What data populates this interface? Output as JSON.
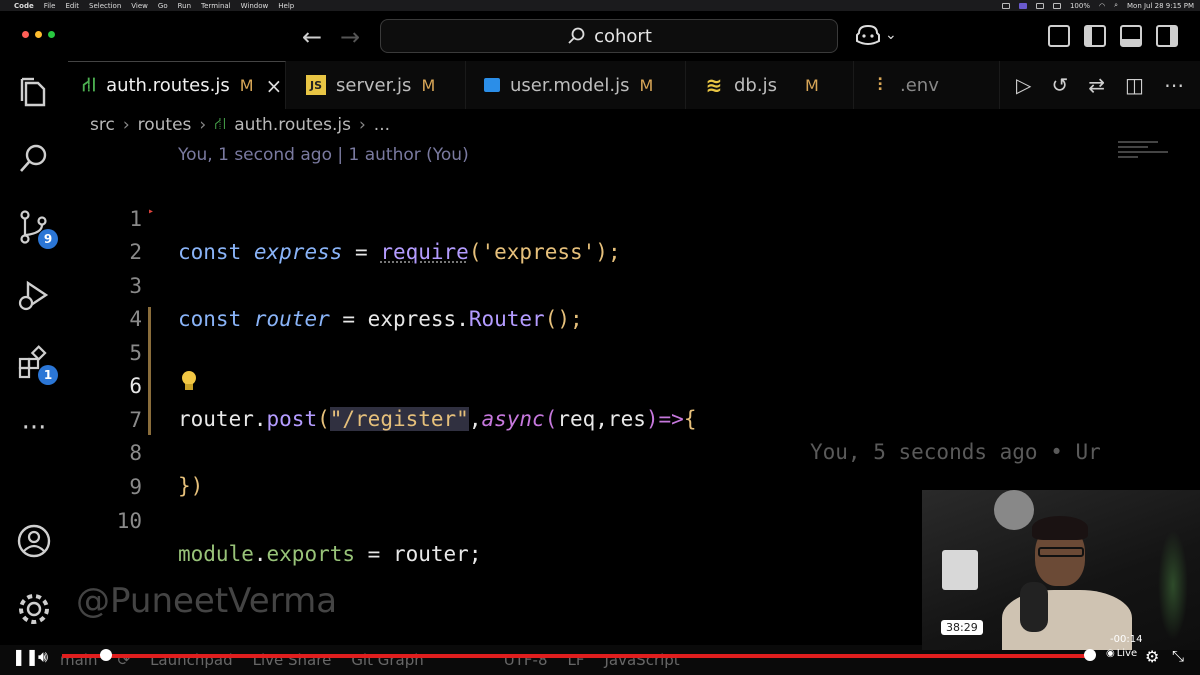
{
  "menubar": {
    "app": "Code",
    "items": [
      "File",
      "Edit",
      "Selection",
      "View",
      "Go",
      "Run",
      "Terminal",
      "Window",
      "Help"
    ],
    "battery": "100%",
    "clock": "Mon Jul 28  9:15 PM"
  },
  "titlebar": {
    "search_text": "cohort",
    "traffic_colors": [
      "#ff5f57",
      "#febc2e",
      "#28c840"
    ]
  },
  "activity": {
    "scm_badge": "9",
    "extensions_badge": "1",
    "more": "···"
  },
  "tabs": [
    {
      "label": "auth.routes.js",
      "mod": "M",
      "active": true,
      "icon": "route-icon",
      "close": "×"
    },
    {
      "label": "server.js",
      "mod": "M",
      "icon": "js-icon",
      "icon_text": "JS"
    },
    {
      "label": "user.model.js",
      "mod": "M",
      "icon": "model-icon"
    },
    {
      "label": "db.js",
      "mod": "M",
      "icon": "database-icon"
    },
    {
      "label": ".env",
      "mod": "",
      "icon": "settings-sliders-icon"
    }
  ],
  "breadcrumb": [
    "src",
    "routes",
    "auth.routes.js",
    "..."
  ],
  "editor": {
    "blame_header": "You, 1 second ago | 1 author (You)",
    "line_numbers": [
      "1",
      "2",
      "3",
      "4",
      "5",
      "6",
      "7",
      "8",
      "9",
      "10"
    ],
    "current_line": "6",
    "ghost_blame": "You, 5 seconds ago • Ur",
    "watermark": "@PuneetVerma",
    "tokens": {
      "const": "const",
      "express": "express",
      "eq": " = ",
      "require": "require",
      "lp": "(",
      "express_str": "'express'",
      "rp_semi": ");",
      "router": "router",
      "express_plain": "express",
      "dot": ".",
      "Router": "Router",
      "call_semi": "();",
      "post": "post",
      "register_str": "\"/register\"",
      "comma": ",",
      "async": "async",
      "params": "req,res",
      "arrow": "=>",
      "lbrace": "{",
      "close": "})",
      "module": "module",
      "exports": "exports",
      "router_semi": "router;"
    }
  },
  "statusbar": {
    "branch": "main",
    "launchpad": "Launchpad",
    "liveshare": "Live Share",
    "gitgraph": "Git Graph",
    "encoding": "UTF-8",
    "eol": "LF",
    "language": "JavaScript"
  },
  "video": {
    "progress": 0.998,
    "hover_time": "38:29",
    "remaining": "-00:14",
    "live": "Live"
  }
}
